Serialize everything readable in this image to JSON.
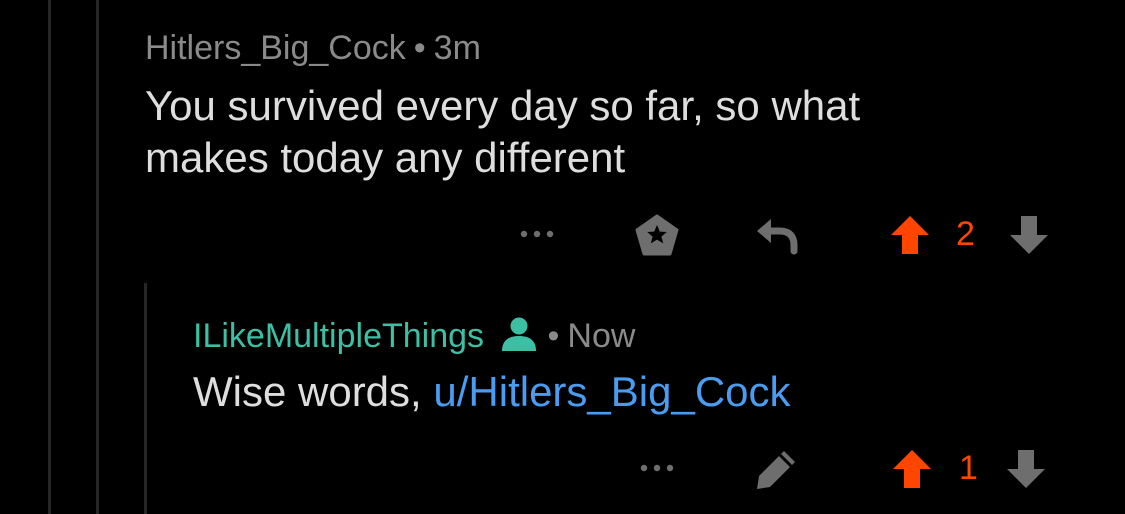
{
  "colors": {
    "background": "#000000",
    "thread_line": "#262626",
    "muted_text": "#8a8a8a",
    "body_text": "#dedede",
    "icon_gray": "#6e6e6e",
    "upvote_active": "#ff4500",
    "op_author": "#3dbfa3",
    "link": "#4a9cf0"
  },
  "comments": [
    {
      "author": "Hitlers_Big_Cock",
      "separator": "•",
      "time": "3m",
      "lines": [
        "You survived every day so far, so what",
        "makes today any different"
      ],
      "actions": [
        "more-icon",
        "award-icon",
        "reply-icon"
      ],
      "score": "2",
      "upvoted": true
    },
    {
      "author": "ILikeMultipleThings",
      "author_icon": "user-icon",
      "separator": "•",
      "time": "Now",
      "text_prefix": "Wise words, ",
      "mention": "u/Hitlers_Big_Cock",
      "actions": [
        "more-icon",
        "edit-icon"
      ],
      "score": "1",
      "upvoted": true
    }
  ]
}
